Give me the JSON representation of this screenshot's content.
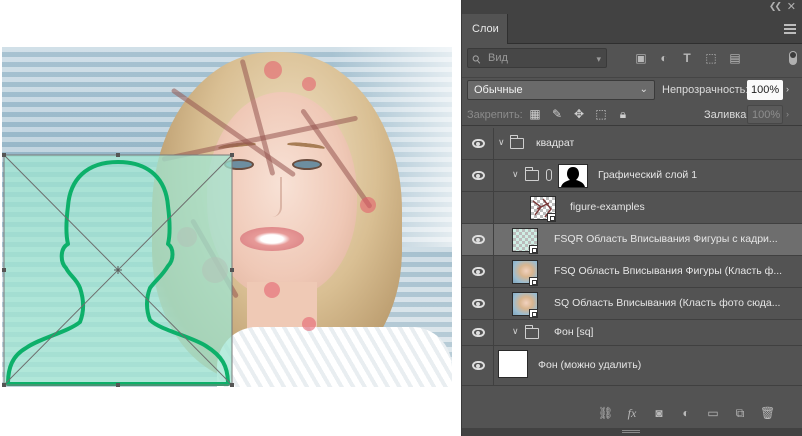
{
  "panel": {
    "tab_label": "Слои",
    "filter": {
      "placeholder": "Вид",
      "icons": [
        "image-filter-icon",
        "adjustment-filter-icon",
        "type-filter-icon",
        "shape-filter-icon",
        "smart-object-filter-icon"
      ]
    },
    "blend_mode": "Обычные",
    "opacity_label": "Непрозрачность:",
    "opacity_value": "100%",
    "lock_label": "Закрепить:",
    "lock_icons": [
      "lock-transparent-icon",
      "lock-image-icon",
      "lock-position-icon",
      "lock-artboard-icon",
      "lock-all-icon"
    ],
    "fill_label": "Заливка:",
    "fill_value": "100%",
    "bottom_icons": [
      "link-layers-icon",
      "fx-icon",
      "add-mask-icon",
      "new-adjustment-icon",
      "new-group-icon",
      "new-layer-icon",
      "delete-layer-icon"
    ]
  },
  "layers": [
    {
      "name": "квадрат",
      "kind": "group",
      "indent": 0,
      "selected": false
    },
    {
      "name": "Графический слой 1",
      "kind": "group-masked",
      "indent": 1,
      "selected": false
    },
    {
      "name": "figure-examples",
      "kind": "smart-object",
      "indent": 2,
      "selected": false
    },
    {
      "name": "FSQR Область Вписывания Фигуры с кадри...",
      "kind": "smart-object",
      "indent": 1,
      "selected": true
    },
    {
      "name": "FSQ Область Вписывания Фигуры (Класть ф...",
      "kind": "smart-photo",
      "indent": 1,
      "selected": false
    },
    {
      "name": "SQ Область Вписывания (Класть фото сюда...",
      "kind": "smart-photo",
      "indent": 1,
      "selected": false
    },
    {
      "name": "Фон [sq]",
      "kind": "group",
      "indent": 1,
      "selected": false
    },
    {
      "name": "Фон (можно удалить)",
      "kind": "background",
      "indent": 0,
      "selected": false
    }
  ],
  "colors": {
    "panel_bg": "#535353",
    "selected_row": "#6e6e6e",
    "silhouette_stroke": "#0db06a",
    "selection_fill": "#a0e6d2"
  }
}
